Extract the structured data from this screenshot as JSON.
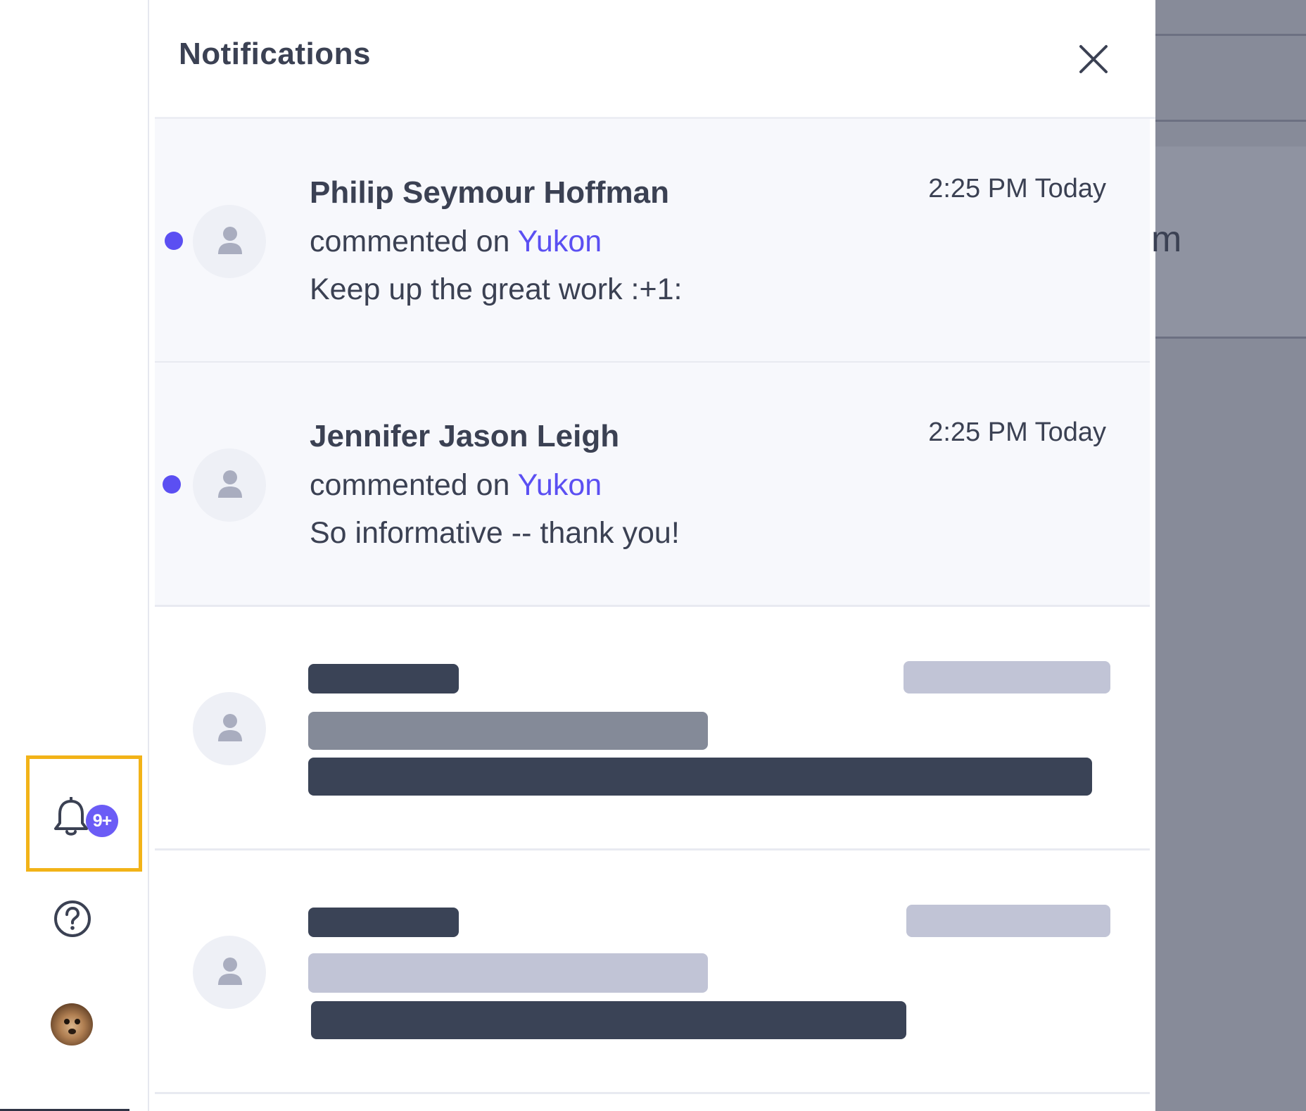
{
  "rail": {
    "notification_badge": "9+",
    "icons": [
      "bell-icon",
      "help-circle-icon",
      "user-avatar"
    ]
  },
  "panel": {
    "title": "Notifications",
    "close_icon": "close-icon",
    "notifications": [
      {
        "name": "Philip Seymour Hoffman",
        "time": "2:25 PM Today",
        "action": "commented on",
        "target": "Yukon",
        "comment": "Keep up the great work :+1:",
        "unread": true
      },
      {
        "name": "Jennifer Jason Leigh",
        "time": "2:25 PM Today",
        "action": "commented on",
        "target": "Yukon",
        "comment": "So informative -- thank you!",
        "unread": true
      }
    ]
  },
  "backdrop": {
    "partial_text": "m"
  },
  "colors": {
    "accent": "#5b4ff2",
    "badge": "#6b5cf6",
    "highlight": "#f2b318",
    "text": "#3b4153",
    "backdrop": "#878b99"
  }
}
